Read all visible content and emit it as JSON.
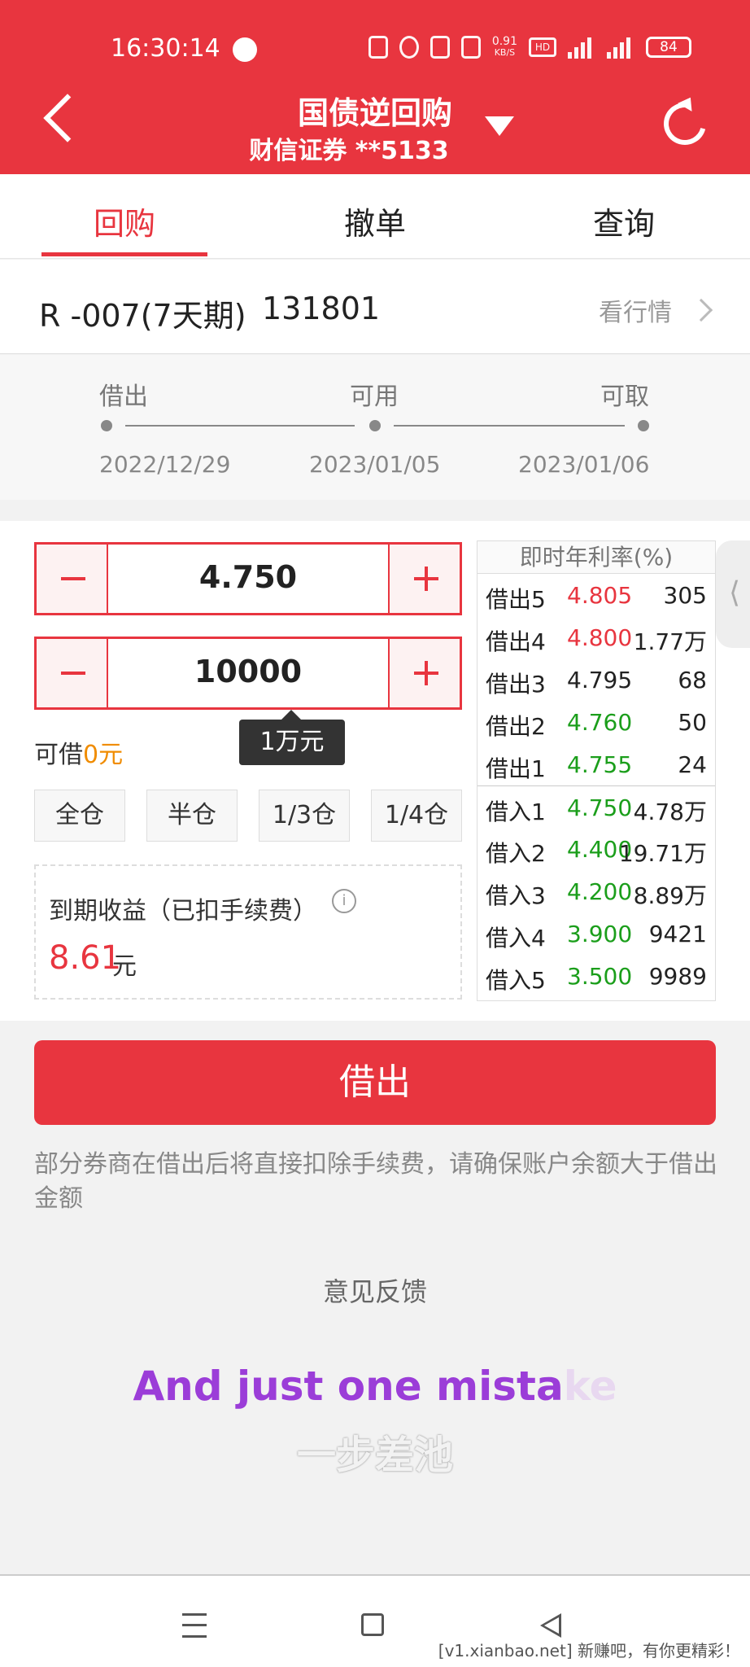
{
  "status_bar": {
    "time": "16:30:14",
    "net_speed": "0.91",
    "net_unit": "KB/S",
    "hd": "HD",
    "sig1": "5G",
    "sig2": "4G",
    "battery": "84"
  },
  "header": {
    "title": "国债逆回购",
    "subtitle": "财信证券 **5133"
  },
  "tabs": [
    {
      "label": "回购"
    },
    {
      "label": "撤单"
    },
    {
      "label": "查询"
    }
  ],
  "product": {
    "name": "R -007(7天期)",
    "code": "131801",
    "market_link": "看行情"
  },
  "timeline": [
    {
      "label": "借出",
      "date": "2022/12/29"
    },
    {
      "label": "可用",
      "date": "2023/01/05"
    },
    {
      "label": "可取",
      "date": "2023/01/06"
    }
  ],
  "order": {
    "rate": "4.750",
    "amount": "10000",
    "amount_hint": "1万元",
    "available_label": "可借",
    "available_value": "0元",
    "positions": [
      "全仓",
      "半仓",
      "1/3仓",
      "1/4仓"
    ],
    "income_label": "到期收益（已扣手续费）",
    "income_value": "8.61",
    "income_unit": "元"
  },
  "order_book": {
    "title": "即时年利率(%)",
    "rows": [
      {
        "label": "借出5",
        "rate": "4.805",
        "vol": "305",
        "color": "red"
      },
      {
        "label": "借出4",
        "rate": "4.800",
        "vol": "1.77万",
        "color": "red"
      },
      {
        "label": "借出3",
        "rate": "4.795",
        "vol": "68",
        "color": "black"
      },
      {
        "label": "借出2",
        "rate": "4.760",
        "vol": "50",
        "color": "green"
      },
      {
        "label": "借出1",
        "rate": "4.755",
        "vol": "24",
        "color": "green"
      },
      {
        "label": "借入1",
        "rate": "4.750",
        "vol": "4.78万",
        "color": "green"
      },
      {
        "label": "借入2",
        "rate": "4.400",
        "vol": "19.71万",
        "color": "green"
      },
      {
        "label": "借入3",
        "rate": "4.200",
        "vol": "8.89万",
        "color": "green"
      },
      {
        "label": "借入4",
        "rate": "3.900",
        "vol": "9421",
        "color": "green"
      },
      {
        "label": "借入5",
        "rate": "3.500",
        "vol": "9989",
        "color": "green"
      }
    ]
  },
  "lend_button": "借出",
  "notice": "部分券商在借出后将直接扣除手续费，请确保账户余额大于借出金额",
  "feedback": "意见反馈",
  "overlay_subtitle": {
    "en_main": "And just one mista",
    "en_fade": "ke",
    "cn": "一步差池"
  },
  "watermark": "[v1.xianbao.net] 新赚吧，有你更精彩！",
  "colors": {
    "accent": "#e8353f",
    "rise": "#e8353f",
    "fall": "#1b9e1b",
    "warning": "#f08c00"
  }
}
